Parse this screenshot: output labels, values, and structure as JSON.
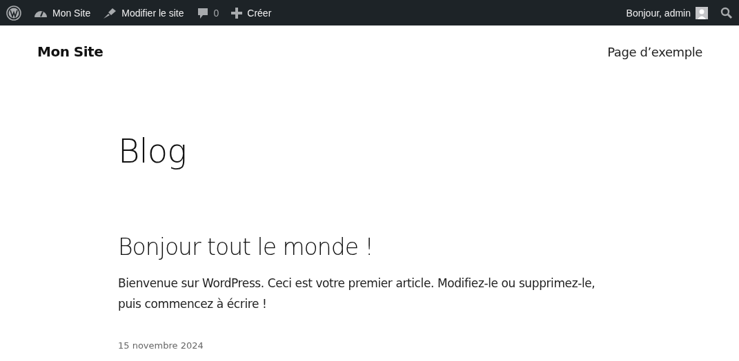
{
  "admin_bar": {
    "items": [
      {
        "kind": "logo"
      },
      {
        "kind": "dashboard",
        "label": "Mon Site"
      },
      {
        "kind": "brush",
        "label": "Modifier le site"
      },
      {
        "kind": "comments",
        "label": "0"
      },
      {
        "kind": "plus",
        "label": "Créer"
      }
    ],
    "greeting": "Bonjour, admin"
  },
  "header": {
    "site_title": "Mon Site",
    "nav": [
      "Page d’exemple"
    ]
  },
  "page_title": "Blog",
  "posts": [
    {
      "title": "Bonjour tout le monde !",
      "excerpt": "Bienvenue sur WordPress. Ceci est votre premier article. Modifiez-le ou supprimez-le, puis commencez à écrire !",
      "date": "15 novembre 2024"
    }
  ]
}
